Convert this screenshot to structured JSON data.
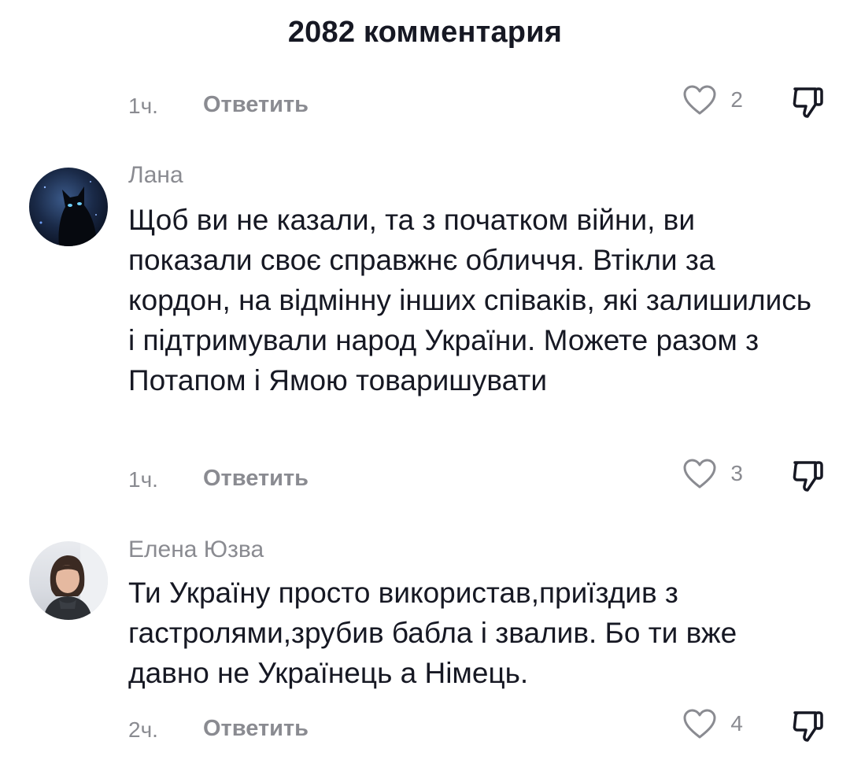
{
  "header": {
    "title": "2082 комментария"
  },
  "comments": [
    {
      "time": "1ч.",
      "reply_label": "Ответить",
      "likes": "2"
    },
    {
      "author": "Лана",
      "text": "Щоб ви не казали, та з початком війни, ви показали своє справжнє обличчя. Втікли за кордон, на відмінну інших співаків, які залишились і підтримували народ України. Можете разом з Потапом і Ямою товаришувати",
      "time": "1ч.",
      "reply_label": "Ответить",
      "likes": "3"
    },
    {
      "author": "Елена Юзва",
      "text": "Ти Україну просто використав,приїздив з гастролями,зрубив бабла і звалив. Бо ти вже давно не Українець а Німець.",
      "time": "2ч.",
      "reply_label": "Ответить",
      "likes": "4"
    }
  ],
  "colors": {
    "text_primary": "#161823",
    "text_secondary": "#8a8b91",
    "background": "#ffffff"
  },
  "icons": [
    "heart-outline-icon",
    "dislike-icon"
  ]
}
